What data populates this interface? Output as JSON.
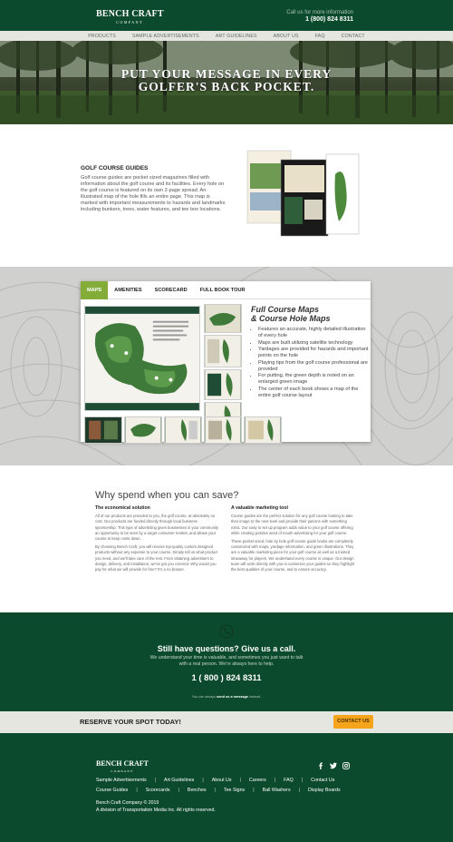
{
  "header": {
    "logo_main": "BENCH CRAFT",
    "logo_sub": "COMPANY",
    "call_label": "Call us for more information",
    "call_number": "1 (800) 824 8311"
  },
  "nav": [
    "PRODUCTS",
    "SAMPLE ADVERTISEMENTS",
    "ART GUIDELINES",
    "ABOUT US",
    "FAQ",
    "CONTACT"
  ],
  "hero": {
    "line1": "PUT YOUR MESSAGE IN EVERY",
    "line2": "GOLFER'S BACK POCKET."
  },
  "guides": {
    "title": "GOLF COURSE GUIDES",
    "text": "Golf course guides are pocket sized magazines filled with information about the golf course and its facilities. Every hole on the golf course is featured on its own 2-page spread. An illustrated map of the hole fills an entire page. This map is marked with important measurements to hazards and landmarks including bunkers, trees, water features, and tee box locations."
  },
  "tabs": {
    "items": [
      "MAPS",
      "AMENITIES",
      "SCORECARD",
      "FULL BOOK TOUR"
    ],
    "active": "MAPS",
    "heading1": "Full Course Maps",
    "heading2": "& Course Hole Maps",
    "features": [
      "Features an accurate, highly detailed illustration of every hole",
      "Maps are built utilizing satellite technology",
      "Yardages are provided for hazards and important points on the hole",
      "Playing tips from the golf course professional are provided",
      "For putting, the green depth is noted on an enlarged green image",
      "The center of each book shows a map of the entire golf course layout"
    ]
  },
  "why": {
    "heading": "Why spend when you can save?",
    "col1_title": "The economical solution",
    "col1_p1": "All of our products are provided to you, the golf course, at absolutely no cost. Our products are funded directly through local business sponsorship. This type of advertising gives businesses in your community an opportunity to be seen by a target consumer market, and allows your course to keep costs down.",
    "col1_p2": "By choosing Bench Craft, you will receive top-quality custom designed products without any expense to your course. Simply tell us what product you need, and we'll take care of the rest. From obtaining advertisers to design, delivery, and installation, we've got you covered. Why would you pay for what we will provide for free? It's a no brainer.",
    "col2_title": "A valuable marketing tool",
    "col2_p1": "Course guides are the perfect solution for any golf course looking to take their image to the next level and provide their patrons with something extra. Our easy to set up program adds value to your golf course offering while creating positive word of mouth advertising for your golf course.",
    "col2_p2": "These pocket sized, hole by hole golf course guide books are completely customized with maps, yardage information, and green illustrations. They are a valuable marketing piece for your golf course as well as a trusted stowaway for players. We understand every course is unique. Our design team will work directly with you to customize your guides so they highlight the best qualities of your course, and to ensure accuracy."
  },
  "questions": {
    "title": "Still have questions? Give us a call.",
    "sub1": "We understand your time is valuable, and sometimes you just want to talk",
    "sub2": "with a real person. We're always here to help.",
    "number": "1 ( 800 ) 824 8311",
    "foot_pre": "You can always",
    "foot_link": "send us a message",
    "foot_post": "instead."
  },
  "reserve": {
    "text": "RESERVE YOUR SPOT TODAY!",
    "button": "CONTACT US"
  },
  "footer": {
    "logo_main": "BENCH CRAFT",
    "logo_sub": "COMPANY",
    "row1": [
      "Sample Advertisements",
      "Art Guidelines",
      "About Us",
      "Careers",
      "FAQ",
      "Contact Us"
    ],
    "row2": [
      "Course Guides",
      "Scorecards",
      "Benches",
      "Tee Signs",
      "Ball Washers",
      "Display Boards"
    ],
    "copyright": "Bench Craft Company © 2019",
    "division": "A division of Transportation Media Inc. All rights reserved.",
    "social": [
      "facebook-icon",
      "twitter-icon",
      "instagram-icon"
    ]
  },
  "colors": {
    "brand_green": "#0b4a2c",
    "tab_green": "#83ad38",
    "button_orange": "#f7a41d",
    "nav_bg": "#e6e6e0"
  }
}
